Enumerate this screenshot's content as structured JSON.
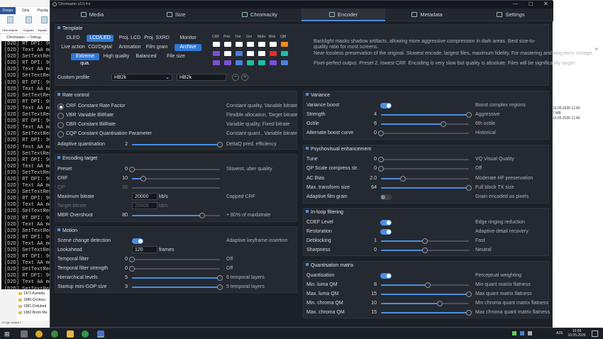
{
  "explorer": {
    "tabs": [
      "Dosya",
      "Giriş",
      "Paylaş"
    ],
    "ribbon": [
      "Hızlı erişime",
      "Kopyala",
      "Yapıştır"
    ],
    "console_title": "Chromaster — Debug",
    "console_lines": [
      "[D2D] RT DPI: 96 x 96",
      "[D2D] Text AA mode:",
      "[D2D] SetTextRenderi",
      "[D2D] RT DPI: 96 x 96",
      "[D2D] Text AA mode:",
      "[D2D] SetTextRenderi",
      "[D2D] RT DPI: 96 x 96",
      "[D2D] Text AA mode:",
      "[D2D] SetTextRenderi",
      "[D2D] RT DPI: 96 x 96",
      "[D2D] Text AA mode:",
      "[D2D] SetTextRenderi",
      "[D2D] RT DPI: 96 x 96",
      "[D2D] Text AA mode:",
      "[D2D] SetTextRenderi",
      "[D2D] RT DPI: 96 x 96",
      "[D2D] Text AA mode:",
      "[D2D] SetTextRenderi",
      "[D2D] RT DPI: 96 x 96",
      "[D2D] Text AA mode:",
      "[D2D] SetTextRenderi",
      "[D2D] RT DPI: 96 x 96",
      "[D2D] Text AA mode:",
      "[D2D] SetTextRenderi",
      "[D2D] RT DPI: 96 x 96",
      "[D2D] Text AA mode:",
      "[D2D] SetTextRenderi",
      "[D2D] RT DPI: 96 x 96",
      "[D2D] Text AA mode:",
      "[D2D] SetTextRenderi",
      "[D2D] RT DPI: 96 x 96",
      "[D2D] Text AA mode:",
      "[D2D] SetTextRenderi",
      "[D2D] RT DPI: 96 x 96",
      "[D2D] Text AA mode:",
      "[D2D] SetTextRenderi",
      "[D2D] RT DPI: 96 x 96",
      "[D2D] Text AA mode:",
      "[D2D] SetTextRenderi"
    ],
    "files": [
      "1971-Kandda",
      "1980-Qızıleyu",
      "1981-Ordubad",
      "1982-Bizim Ma"
    ],
    "status": "10 öğe   seçildi 1"
  },
  "rightbg": {
    "dates": [
      "10.05.2026 11:40",
      "7 MB",
      "10.05.2026 11:40"
    ]
  },
  "window": {
    "title": "Chromaster v2.0.4 α",
    "tabs": [
      {
        "label": "Media",
        "icon": "film-icon"
      },
      {
        "label": "Size",
        "icon": "resize-icon"
      },
      {
        "label": "Chromacity",
        "icon": "cloud-icon"
      },
      {
        "label": "Encoder",
        "icon": "chip-icon"
      },
      {
        "label": "Metadata",
        "icon": "tag-icon"
      },
      {
        "label": "Settings",
        "icon": "gear-icon"
      }
    ],
    "active_tab": "Encoder"
  },
  "template": {
    "title": "Template",
    "row1": [
      "OLED",
      "LCD/LED",
      "Proj. LCD",
      "Proj. SXRD",
      "Monitor"
    ],
    "row2": [
      "Live action",
      "CGI/Digital",
      "Animation",
      "Film grain",
      "Archive"
    ],
    "row3": [
      "Extreme qua.",
      "High quality",
      "Balanced",
      "File size"
    ],
    "col_headers": [
      "CRF",
      "Prst",
      "Txtr",
      "Grn",
      "Motn",
      "Blck",
      "QM"
    ],
    "swatches": [
      [
        "#ffffff",
        "#ffffff",
        "#ffffff",
        "#ffffff",
        "#ffffff",
        "#ffffff",
        "#f28a1e"
      ],
      [
        "#7b4fd6",
        "#ffffff",
        "#4a7fe0",
        "#ffffff",
        "#ffffff",
        "#e0302a",
        "#1fbfa5"
      ],
      [
        "#7b4fd6",
        "#7b4fd6",
        "#4a7fe0",
        "#1fbfa5",
        "#1fbfa5",
        "#7b4fd6",
        "#4a7fe0"
      ]
    ],
    "desc": [
      "Backlight masks shadow artifacts, allowing more aggressive compression in dark areas. Best size-to-quality ratio for most screens.",
      "Near-lossless preservation of the original. Slowest encode, largest files, maximum fidelity. For mastering and long-term storage.",
      "Pixel-perfect output. Preset 2, lowest CRF. Encoding is very slow but quality is absolute. Files will be significantly larger."
    ],
    "profile_label": "Custom profile",
    "profile_value": "HB2k",
    "profile_name": "HB2k"
  },
  "rate": {
    "title": "Rate control",
    "options": [
      {
        "code": "CRF",
        "name": "Constant Rate Factor",
        "desc": "Constant quality, Variable bitrate",
        "on": true
      },
      {
        "code": "VBR",
        "name": "Variable BitRate",
        "desc": "Flexible allocation, Target bitrate",
        "on": false
      },
      {
        "code": "CBR",
        "name": "Constant BitRate",
        "desc": "Variable quality, Fixed bitrate",
        "on": false
      },
      {
        "code": "CQP",
        "name": "Constant Quantisation Parameter",
        "desc": "Constant quant., Variable bitrate",
        "on": false
      }
    ],
    "aq_label": "Adaptive quantisation",
    "aq_value": "2",
    "aq_frac": 1.0,
    "aq_desc": "DeltaQ pred. efficiency"
  },
  "enc": {
    "title": "Encoding target",
    "preset": {
      "label": "Preset",
      "value": "0",
      "frac": 0.0,
      "desc": "Slowest, uber quality"
    },
    "crf": {
      "label": "CRF",
      "value": "10",
      "frac": 0.13
    },
    "qp": {
      "label": "QP",
      "value": "35"
    },
    "maxbr": {
      "label": "Maximum bitrate",
      "value": "20000",
      "unit": "kb/s",
      "desc": "Capped CRF"
    },
    "tgtbr": {
      "label": "Target bitrate",
      "value": "20000",
      "unit": "kb/s"
    },
    "mbr": {
      "label": "MBR Overshoot",
      "value": "80",
      "frac": 0.8,
      "desc": "+ 80% of maxbitrate"
    }
  },
  "motion": {
    "title": "Motion",
    "scd": {
      "label": "Scene change detection",
      "desc": "Adaptive keyframe insertion"
    },
    "look": {
      "label": "Lookahead",
      "value": "120",
      "unit": "frames"
    },
    "tf": {
      "label": "Temporal filter",
      "value": "0",
      "frac": 0.0,
      "desc": "Off"
    },
    "tfs": {
      "label": "Temporal filter strength",
      "value": "0",
      "frac": 0.0,
      "desc": "Off"
    },
    "hl": {
      "label": "Hierarchical levels",
      "value": "5",
      "frac": 1.0,
      "desc": "6 temporal layers"
    },
    "sg": {
      "label": "Startup mini-GOP size",
      "value": "3",
      "frac": 1.0,
      "desc": "5 temporal layers"
    }
  },
  "variance": {
    "title": "Variance",
    "boost": {
      "label": "Variance boost",
      "desc": "Boost complex regions"
    },
    "strength": {
      "label": "Strength",
      "value": "4",
      "frac": 1.0,
      "desc": "Aggressive"
    },
    "octile": {
      "label": "Octile",
      "value": "6",
      "frac": 0.71,
      "desc": "6th octile"
    },
    "curve": {
      "label": "Alternate boost curve",
      "value": "0",
      "frac": 0.0,
      "desc": "Historical"
    }
  },
  "psy": {
    "title": "Psychovisual enhancement",
    "tune": {
      "label": "Tune",
      "value": "0",
      "frac": 0.0,
      "desc": "VQ Visual Quality"
    },
    "qpsc": {
      "label": "QP Scale compress str.",
      "value": "0",
      "frac": 0.0,
      "desc": "Off"
    },
    "acb": {
      "label": "AC Bias",
      "value": "2.0",
      "frac": 0.25,
      "desc": "Moderate HF preservation"
    },
    "mts": {
      "label": "Max. transform size",
      "value": "64",
      "frac": 1.0,
      "desc": "Full block TX size"
    },
    "afg": {
      "label": "Adaptive film grain",
      "desc": "Grain encoded as pixels"
    }
  },
  "loop": {
    "title": "In-loop filtering",
    "cdef": {
      "label": "CDEF Level",
      "desc": "Edge ringing reduction"
    },
    "rest": {
      "label": "Restoration",
      "desc": "Adaptive detail recovery"
    },
    "deb": {
      "label": "Deblocking",
      "value": "1",
      "frac": 0.5,
      "desc": "Fast"
    },
    "shp": {
      "label": "Sharpness",
      "value": "0",
      "frac": 0.5,
      "desc": "Neutral"
    }
  },
  "quant": {
    "title": "Quantisation matrix",
    "qm": {
      "label": "Quantisation",
      "desc": "Perceptual weighting"
    },
    "minl": {
      "label": "Min. luma QM",
      "value": "8",
      "frac": 0.53,
      "desc": "Min quant matrix flatness"
    },
    "maxl": {
      "label": "Max. luma QM",
      "value": "15",
      "frac": 1.0,
      "desc": "Max quant matrix flatness"
    },
    "minc": {
      "label": "Min. chroma QM",
      "value": "10",
      "frac": 0.67,
      "desc": "Min chroma quant matrix flatness"
    },
    "maxc": {
      "label": "Max. chroma QM",
      "value": "15",
      "frac": 1.0,
      "desc": "Max chroma quant matrix flatness"
    }
  },
  "taskbar": {
    "lang": "AZE",
    "time": "15:58",
    "date": "10.05.2026"
  }
}
